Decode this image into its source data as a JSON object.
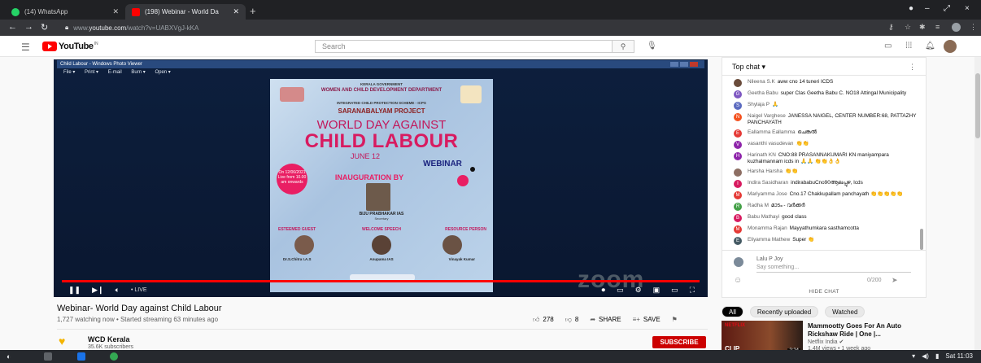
{
  "browser": {
    "tabs": [
      {
        "label": "(14) WhatsApp",
        "favicon": "whatsapp-icon",
        "color": "#25d366"
      },
      {
        "label": "(198) Webinar - World Da",
        "favicon": "youtube-icon",
        "color": "#ff0000"
      }
    ],
    "new_tab": "+",
    "window_controls": [
      "●",
      "–",
      "⤢",
      "×"
    ],
    "url_host": "youtube.com",
    "url_path": "/watch?v=UABXVgJ-kKA",
    "url_scheme": "www."
  },
  "youtube": {
    "logo_text": "YouTube",
    "logo_region": "IN",
    "search_placeholder": "Search"
  },
  "video": {
    "photo_viewer_title": "Child Labour - Windows Photo Viewer",
    "photo_viewer_menu": [
      "File ▾",
      "Print ▾",
      "E-mail",
      "Burn ▾",
      "Open ▾"
    ],
    "poster": {
      "gov": "KERALA GOVERNMENT",
      "dept": "WOMEN AND CHILD DEVELOPMENT DEPARTMENT",
      "scheme": "INTEGRATED CHILD PROTECTION SCHEME - ICPS",
      "project": "SARANABALYAM PROJECT",
      "line1": "WORLD DAY AGAINST",
      "line2": "CHILD LABOUR",
      "date": "JUNE 12",
      "webinar": "WEBINAR",
      "on_label": "On 12/06/2021 Live from 10.00 am onwards",
      "inauguration": "INAUGURATION BY",
      "inaugurator": "BIJU PRABHAKAR IAS",
      "inaugurator_role": "Secretary",
      "guest_label": "ESTEEMED GUEST",
      "welcome_label": "WELCOME SPEECH",
      "resource_label": "RESOURCE PERSON",
      "guest_name": "Dr.S.Chitra I.A.S",
      "welcome_name": "Anupama IAS",
      "resource_name": "Vinayak Kumar"
    },
    "zoom_watermark": "zoom",
    "live_label": "• LIVE",
    "progress": 1.0,
    "title": "Webinar- World Day against Child Labour",
    "meta": "1,727 watching now • Started streaming 63 minutes ago",
    "likes": "278",
    "dislikes": "8",
    "share": "SHARE",
    "save": "SAVE",
    "channel_name": "WCD Kerala",
    "channel_subs": "35.6K subscribers",
    "subscribe": "SUBSCRIBE"
  },
  "chat": {
    "header": "Top chat ▾",
    "messages": [
      {
        "author": "Nileena S.K",
        "text": "aww cno 14 tuneri ICDS",
        "initial": "",
        "color": "#6a4c3b"
      },
      {
        "author": "Geetha Babu",
        "text": "super Clas Geetha Babu C. NO18 Attingal Municipality",
        "initial": "G",
        "color": "#7e57c2"
      },
      {
        "author": "Shylaja P",
        "text": "🙏",
        "initial": "S",
        "color": "#5c6bc0"
      },
      {
        "author": "Naigel Varghese",
        "text": "JANESSA NAIGEL, CENTER NUMBER:68, PATTAZHY PANCHAYATH",
        "initial": "N",
        "color": "#f4511e"
      },
      {
        "author": "Eallamma Eallamma",
        "text": "ചെങ്കൽ",
        "initial": "E",
        "color": "#e53935"
      },
      {
        "author": "vasanthi vasudevan",
        "text": "👏👏",
        "initial": "V",
        "color": "#8e24aa"
      },
      {
        "author": "Harinath KN",
        "text": "CNO:88 PRASANNAKUMARI KN maniyampara kuzhalmannam icds in 🙏🙏 👏👏👌👌",
        "initial": "H",
        "color": "#8e24aa"
      },
      {
        "author": "Harsha Harsha",
        "text": "👏👏",
        "initial": "",
        "color": "#8d6e63"
      },
      {
        "author": "Indira Sasidharan",
        "text": "indirababuCno90ആലപ്പുഴ, Icds",
        "initial": "I",
        "color": "#d81b60"
      },
      {
        "author": "Mariyamma Jose",
        "text": "Cno.17 Chakkupallam panchayath 👏👏👏👏👏",
        "initial": "M",
        "color": "#e53935"
      },
      {
        "author": "Radha M",
        "text": "മാടം - വർക്കർ",
        "initial": "R",
        "color": "#43a047"
      },
      {
        "author": "Babu Mathayi",
        "text": "good class",
        "initial": "B",
        "color": "#d81b60"
      },
      {
        "author": "Monamma Rajan",
        "text": "Mayyathumkara sasthamcotta",
        "initial": "M",
        "color": "#e53935"
      },
      {
        "author": "Eliyamma Mathew",
        "text": "Super 👏",
        "initial": "E",
        "color": "#455a64"
      }
    ],
    "composer_name": "Lalu P Joy",
    "composer_placeholder": "Say something...",
    "char_count": "0/200",
    "hide_chat": "HIDE CHAT"
  },
  "recommendations": {
    "chips": [
      "All",
      "Recently uploaded",
      "Watched"
    ],
    "item": {
      "badge": "NETFLIX",
      "thumb_label": "CLIP",
      "duration": "2:24",
      "title": "Mammootty Goes For An Auto Rickshaw Ride | One |...",
      "channel": "Netflix India ✔",
      "meta": "1.4M views • 1 week ago"
    }
  },
  "shelf": {
    "clock": "Sat 11:03"
  }
}
